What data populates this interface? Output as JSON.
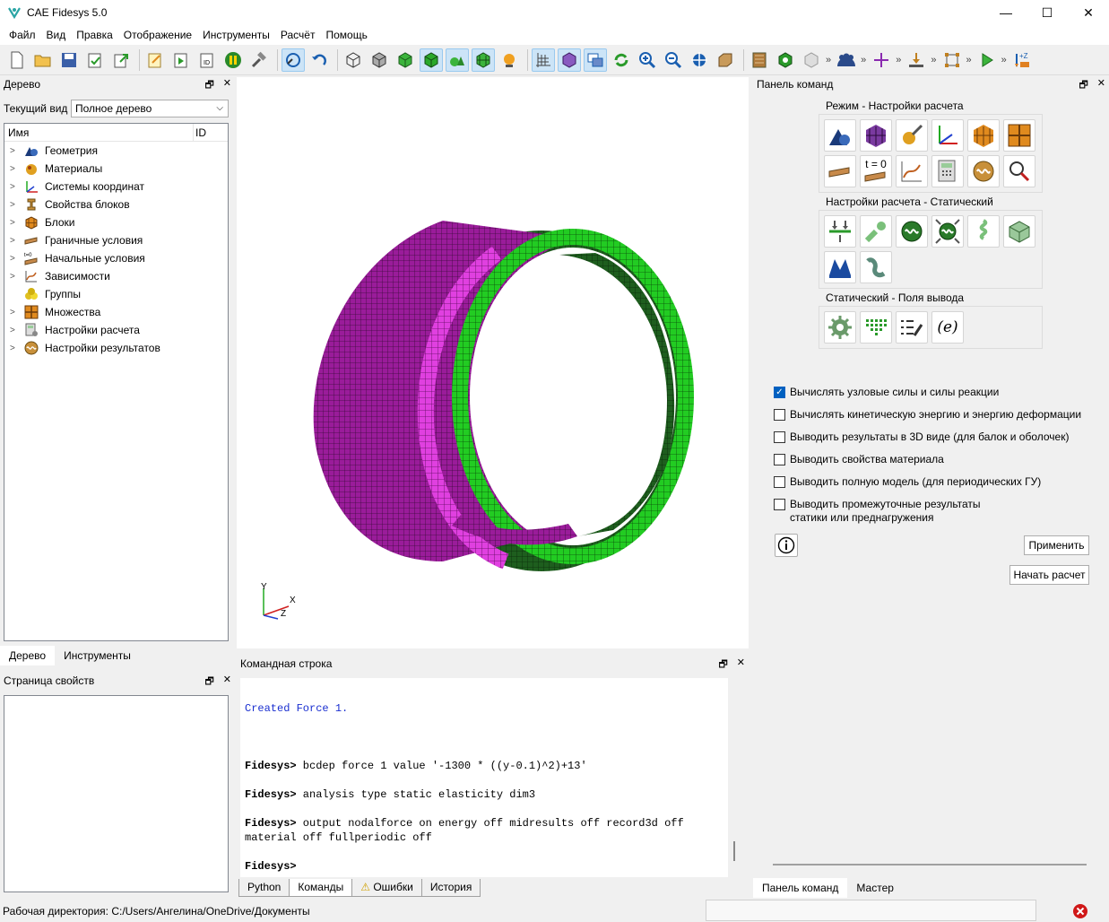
{
  "window": {
    "title": "CAE Fidesys 5.0",
    "minimize_glyph": "—",
    "maximize_glyph": "☐",
    "close_glyph": "✕"
  },
  "menu": [
    "Файл",
    "Вид",
    "Правка",
    "Отображение",
    "Инструменты",
    "Расчёт",
    "Помощь"
  ],
  "tree_panel": {
    "title": "Дерево",
    "current_view_label": "Текущий вид",
    "current_view_value": "Полное дерево",
    "col_name": "Имя",
    "col_id": "ID",
    "items": [
      {
        "label": "Геометрия",
        "icon": "geometry-icon",
        "expandable": true
      },
      {
        "label": "Материалы",
        "icon": "materials-icon",
        "expandable": true
      },
      {
        "label": "Системы координат",
        "icon": "coordinate-systems-icon",
        "expandable": true
      },
      {
        "label": "Свойства блоков",
        "icon": "block-properties-icon",
        "expandable": true
      },
      {
        "label": "Блоки",
        "icon": "blocks-icon",
        "expandable": true
      },
      {
        "label": "Граничные условия",
        "icon": "boundary-conditions-icon",
        "expandable": true
      },
      {
        "label": "Начальные условия",
        "icon": "initial-conditions-icon",
        "expandable": true
      },
      {
        "label": "Зависимости",
        "icon": "dependencies-icon",
        "expandable": true
      },
      {
        "label": "Группы",
        "icon": "groups-icon",
        "expandable": false
      },
      {
        "label": "Множества",
        "icon": "sets-icon",
        "expandable": true
      },
      {
        "label": "Настройки расчета",
        "icon": "calc-settings-icon",
        "expandable": true
      },
      {
        "label": "Настройки результатов",
        "icon": "result-settings-icon",
        "expandable": true
      }
    ],
    "tabs": [
      "Дерево",
      "Инструменты"
    ]
  },
  "properties_panel": {
    "title": "Страница свойств"
  },
  "command_line": {
    "title": "Командная строка",
    "lines": [
      {
        "type": "info",
        "text": "Created Force 1."
      },
      {
        "type": "cmd",
        "prompt": "Fidesys>",
        "text": " bcdep force 1 value '-1300 * ((y-0.1)^2)+13'"
      },
      {
        "type": "cmd",
        "prompt": "Fidesys>",
        "text": " analysis type static elasticity dim3"
      },
      {
        "type": "cmd",
        "prompt": "Fidesys>",
        "text": " output nodalforce on energy off midresults off record3d off material off fullperiodic off"
      },
      {
        "type": "cmd",
        "prompt": "Fidesys>",
        "text": ""
      }
    ],
    "tabs": [
      "Python",
      "Команды",
      "Ошибки",
      "История"
    ]
  },
  "command_panel": {
    "title": "Панель команд",
    "group1_title": "Режим - Настройки расчета",
    "group2_title": "Настройки расчета - Статический",
    "group3_title": "Статический - Поля вывода",
    "t0_label": "t = 0",
    "e_label": "(e)",
    "checkboxes": [
      {
        "label": "Вычислять узловые силы и силы реакции",
        "checked": true
      },
      {
        "label": "Вычислять кинетическую энергию и энергию деформации",
        "checked": false
      },
      {
        "label": "Выводить результаты в 3D виде (для балок и оболочек)",
        "checked": false
      },
      {
        "label": "Выводить свойства материала",
        "checked": false
      },
      {
        "label": "Выводить полную модель (для периодических ГУ)",
        "checked": false
      },
      {
        "label": "Выводить промежуточные результаты статики или преднагружения",
        "checked": false
      }
    ],
    "apply_button": "Применить",
    "start_button": "Начать расчет",
    "tabs": [
      "Панель команд",
      "Мастер"
    ]
  },
  "axes": {
    "x": "X",
    "y": "Y",
    "z": "Z"
  },
  "status": {
    "working_dir": "Рабочая директория: C:/Users/Ангелина/OneDrive/Документы"
  },
  "colors": {
    "mesh_magenta": "#a020a0",
    "mesh_magenta_edge": "#e040e0",
    "mesh_green": "#1e6e1e",
    "mesh_green_edge": "#22cc22",
    "accent": "#0060c0"
  }
}
